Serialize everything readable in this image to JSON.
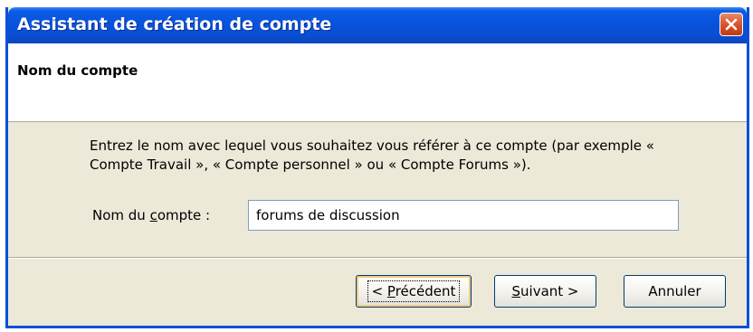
{
  "window": {
    "title": "Assistant de création de compte",
    "close_icon": "close-icon"
  },
  "header": {
    "title": "Nom du compte"
  },
  "content": {
    "description": "Entrez le nom avec lequel vous souhaitez vous référer à ce compte (par exemple « Compte Travail », « Compte personnel » ou « Compte Forums »).",
    "account_name_label": {
      "before": "Nom du ",
      "underline": "c",
      "after": "ompte :"
    },
    "account_name_value": "forums de discussion"
  },
  "buttons": {
    "previous": {
      "before": "< ",
      "underline": "P",
      "after": "récédent"
    },
    "next": {
      "underline": "S",
      "after": "uivant >"
    },
    "cancel": "Annuler"
  },
  "colors": {
    "titlebar": "#0853dd",
    "close_button": "#d8542e",
    "dialog_background": "#ece9d8"
  }
}
